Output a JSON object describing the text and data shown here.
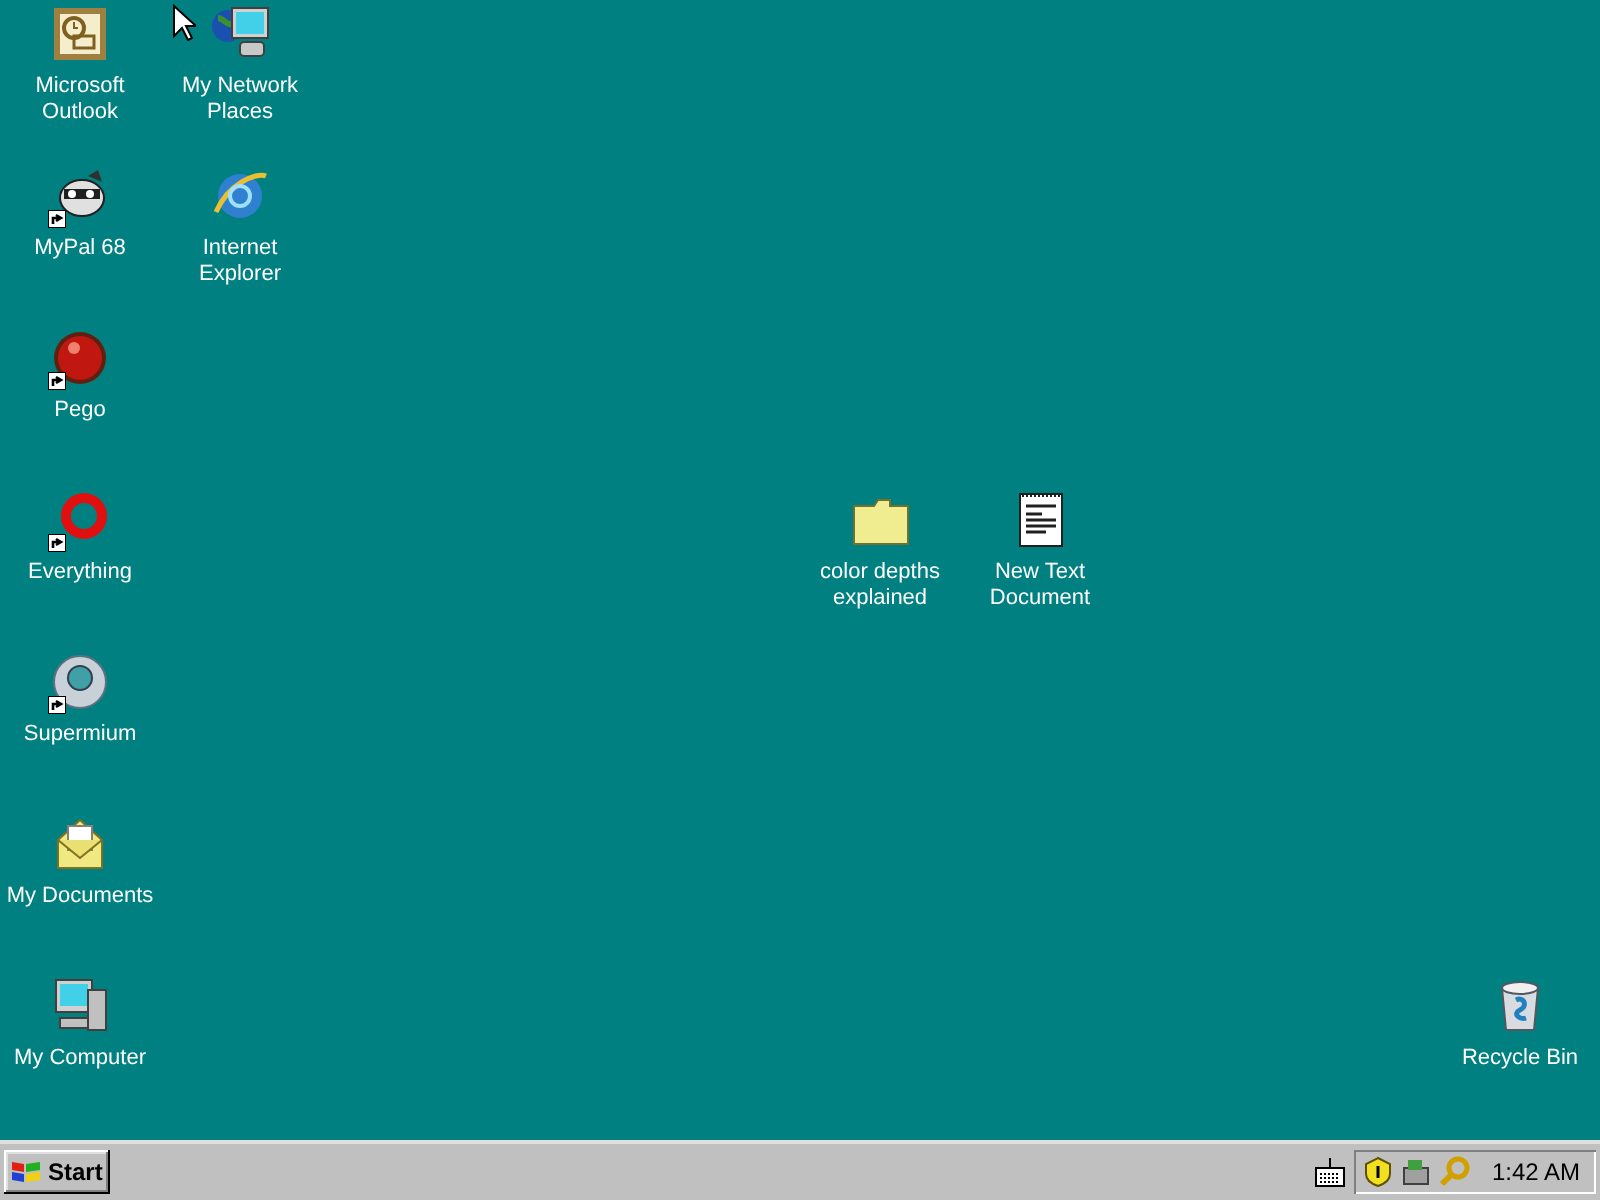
{
  "desktop": {
    "icons": [
      {
        "kind": "outlook",
        "label": "Microsoft Outlook",
        "shortcut": false
      },
      {
        "kind": "network",
        "label": "My Network Places",
        "shortcut": false
      },
      {
        "kind": "mypal",
        "label": "MyPal 68",
        "shortcut": true
      },
      {
        "kind": "ie",
        "label": "Internet Explorer",
        "shortcut": false
      },
      {
        "kind": "pego",
        "label": "Pego",
        "shortcut": true
      },
      {
        "kind": "everything",
        "label": "Everything",
        "shortcut": true
      },
      {
        "kind": "supermium",
        "label": "Supermium",
        "shortcut": true
      },
      {
        "kind": "documents",
        "label": "My Documents",
        "shortcut": false
      },
      {
        "kind": "computer",
        "label": "My Computer",
        "shortcut": false
      },
      {
        "kind": "folder",
        "label": "color depths explained",
        "shortcut": false
      },
      {
        "kind": "textfile",
        "label": "New Text Document",
        "shortcut": false
      },
      {
        "kind": "recycle",
        "label": "Recycle Bin",
        "shortcut": false
      }
    ]
  },
  "taskbar": {
    "start_label": "Start",
    "tray": {
      "clock": "1:42 AM"
    }
  }
}
